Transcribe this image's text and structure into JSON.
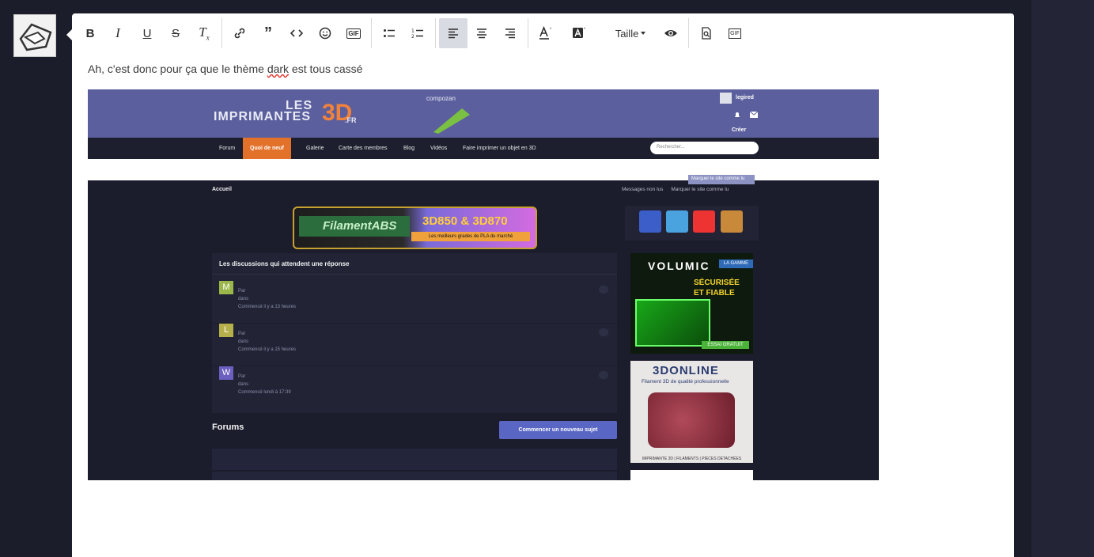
{
  "toolbar": {
    "buttons": [
      "bold",
      "italic",
      "underline",
      "strikethrough",
      "clear-formatting",
      "link",
      "quote",
      "code",
      "emoji",
      "gif",
      "bullet-list",
      "numbered-list",
      "align-left",
      "align-center",
      "align-right",
      "text-color",
      "background-color",
      "size",
      "preview",
      "find",
      "gif-insert"
    ],
    "gif_label": "GIF",
    "size_label": "Taille",
    "active": "align-left"
  },
  "message": {
    "text_before": "Ah, c'est donc pour ça que le thème ",
    "misspelled": "dark",
    "text_after": " est tous cassé"
  },
  "screenshot": {
    "logo_line1": "LES",
    "logo_line2": "IMPRIMANTES",
    "logo_3d": "3D",
    "logo_fr": ".FR",
    "sponsor": "compozan",
    "username": "legired",
    "create_label": "Créer",
    "nav": [
      "Forum",
      "Quoi de neuf",
      "Galerie",
      "Carte des membres",
      "Blog",
      "Vidéos",
      "Faire imprimer un objet en 3D"
    ],
    "search_placeholder": "Rechercher...",
    "breadcrumb": "Accueil",
    "unread": "Messages non lus",
    "mark_read": "Marquer le site comme lu",
    "tooltip": "Marquer le site comme lu",
    "banner_left": "FilamentABS",
    "banner_right": "3D850 & 3D870",
    "banner_tag": "Les meilleurs grades de PLA du marché",
    "panel_title": "Les discussions qui attendent une réponse",
    "threads": [
      {
        "initial": "M",
        "by": "Par",
        "in": "dans",
        "started": "Commencé il y a 13 heures",
        "color": "#9bb74a"
      },
      {
        "initial": "L",
        "by": "Par",
        "in": "dans",
        "started": "Commencé il y a 15 heures",
        "color": "#b5b04a"
      },
      {
        "initial": "W",
        "by": "Par",
        "in": "dans",
        "started": "Commencé lundi à 17:39",
        "color": "#6b5fbf"
      }
    ],
    "forums_title": "Forums",
    "new_topic": "Commencer un nouveau sujet",
    "ad1_brand": "VOLUMIC",
    "ad1_badge": "LA GAMME",
    "ad1_line1": "SÉCURISÉE",
    "ad1_line2": "ET FIABLE",
    "ad1_button": "ESSAI GRATUIT",
    "ad2_title": "3DONLINE",
    "ad2_sub": "Filament 3D de qualité professionnelle",
    "ad2_foot": "IMPRIMANTE 3D | FILAMENTS | PIÈCES DÉTACHÉES"
  },
  "colors": {
    "page_bg": "#1b1d2b",
    "header_bg": "#5b5f9d",
    "nav_active": "#e2712a",
    "button_primary": "#5966c4"
  }
}
